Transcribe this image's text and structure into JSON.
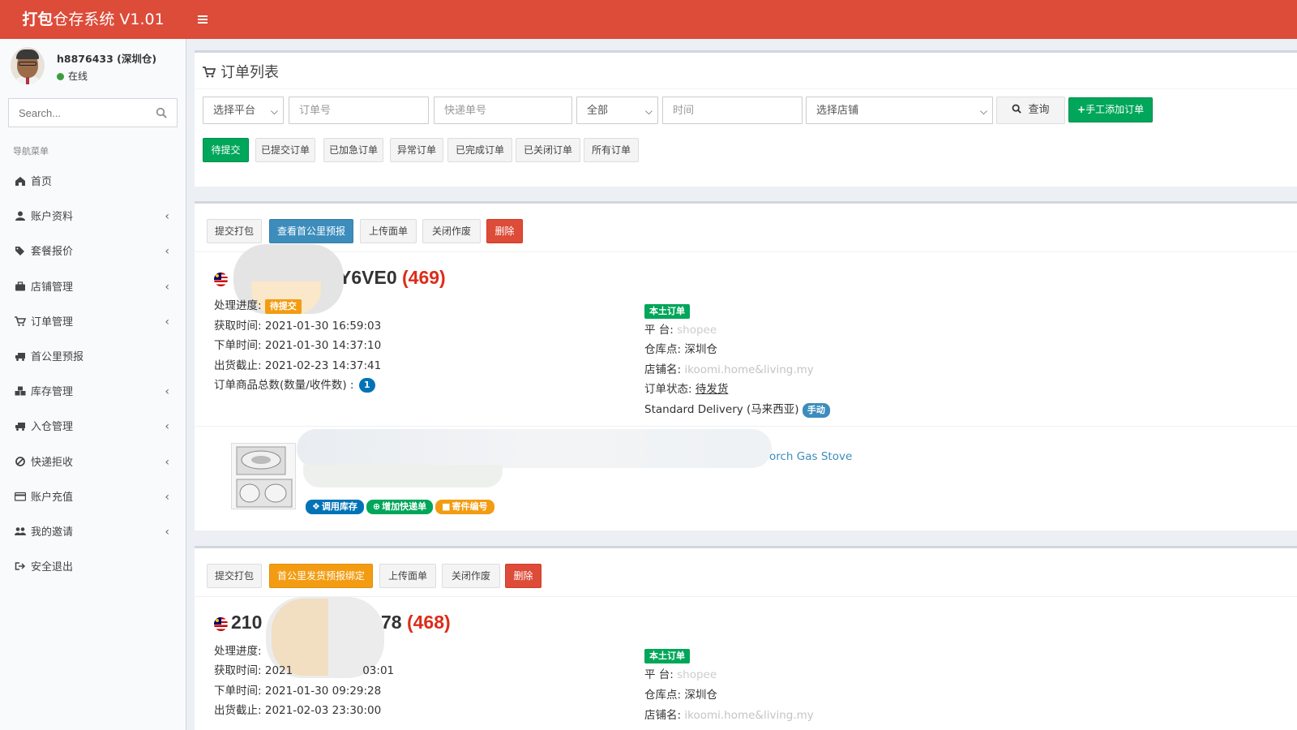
{
  "header": {
    "logo_bold": "打包",
    "logo_rest": "仓存系统 V1.01"
  },
  "sidebar": {
    "user_name": "h8876433 (深圳仓)",
    "user_status": "在线",
    "search_placeholder": "Search...",
    "nav_header": "导航菜单",
    "items": [
      {
        "label": "首页",
        "icon": "home-icon",
        "has_submenu": false
      },
      {
        "label": "账户资料",
        "icon": "user-icon",
        "has_submenu": true
      },
      {
        "label": "套餐报价",
        "icon": "tags-icon",
        "has_submenu": true
      },
      {
        "label": "店铺管理",
        "icon": "briefcase-icon",
        "has_submenu": true
      },
      {
        "label": "订单管理",
        "icon": "cart-icon",
        "has_submenu": true
      },
      {
        "label": "首公里预报",
        "icon": "truck-icon",
        "has_submenu": false
      },
      {
        "label": "库存管理",
        "icon": "cubes-icon",
        "has_submenu": true
      },
      {
        "label": "入仓管理",
        "icon": "truck-icon",
        "has_submenu": true
      },
      {
        "label": "快递拒收",
        "icon": "ban-icon",
        "has_submenu": true
      },
      {
        "label": "账户充值",
        "icon": "credit-card-icon",
        "has_submenu": true
      },
      {
        "label": "我的邀请",
        "icon": "users-icon",
        "has_submenu": true
      },
      {
        "label": "安全退出",
        "icon": "sign-out-icon",
        "has_submenu": false
      }
    ]
  },
  "filter_box": {
    "title": "订单列表",
    "platform_select": "选择平台",
    "order_no_placeholder": "订单号",
    "tracking_placeholder": "快递单号",
    "status_select": "全部",
    "time_placeholder": "时间",
    "shop_select": "选择店铺",
    "query_button": "查询",
    "add_order_button": "手工添加订单",
    "tabs": [
      "待提交",
      "已提交订单",
      "已加急订单",
      "异常订单",
      "已完成订单",
      "已关闭订单",
      "所有订单"
    ],
    "active_tab": "待提交"
  },
  "orders": [
    {
      "actions": [
        "提交打包",
        "查看首公里预报",
        "上传面单",
        "关闭作废",
        "删除"
      ],
      "order_no_visible": "Y6VE0",
      "count": "(469)",
      "progress_label": "处理进度:",
      "progress_value": "待提交",
      "fetch_time_label": "获取时间:",
      "fetch_time": "2021-01-30 16:59:03",
      "order_time_label": "下单时间:",
      "order_time": "2021-01-30 14:37:10",
      "ship_deadline_label": "出货截止:",
      "ship_deadline": "2021-02-23 14:37:41",
      "items_total_label": "订单商品总数(数量/收件数) :",
      "items_total": "1",
      "local_tag": "本土订单",
      "platform_label": "平 台:",
      "platform_value": "shopee",
      "warehouse_label": "仓库点:",
      "warehouse_value": "深圳仓",
      "shop_label": "店铺名:",
      "shop_value": "ikoomi.home&living.my",
      "status_label": "订单状态:",
      "status_value": "待发货",
      "delivery": "Standard Delivery (马来西亚)",
      "delivery_tag": "手动",
      "product_title_tail": "orch Gas Stove",
      "product_actions": [
        "调用库存",
        "增加快递单",
        "寄件编号"
      ]
    },
    {
      "actions": [
        "提交打包",
        "首公里发货预报绑定",
        "上传面单",
        "关闭作废",
        "删除"
      ],
      "order_no_prefix": "210",
      "order_no_suffix": "78",
      "count": "(468)",
      "progress_label": "处理进度:",
      "fetch_time_label": "获取时间:",
      "fetch_time_partial": "2021",
      "fetch_time_tail": "03:01",
      "order_time_label": "下单时间:",
      "order_time": "2021-01-30 09:29:28",
      "ship_deadline_label": "出货截止:",
      "ship_deadline": "2021-02-03 23:30:00",
      "local_tag": "本土订单",
      "platform_label": "平 台:",
      "platform_value": "shopee",
      "warehouse_label": "仓库点:",
      "warehouse_value": "深圳仓",
      "shop_label": "店铺名:",
      "shop_value": "ikoomi.home&living.my"
    }
  ],
  "colors": {
    "topbar": "#dd4b39",
    "green": "#00a65a",
    "blue": "#3c8dbc",
    "red": "#dd4b39",
    "orange": "#f39c12",
    "count_red": "#dd2c1a"
  }
}
